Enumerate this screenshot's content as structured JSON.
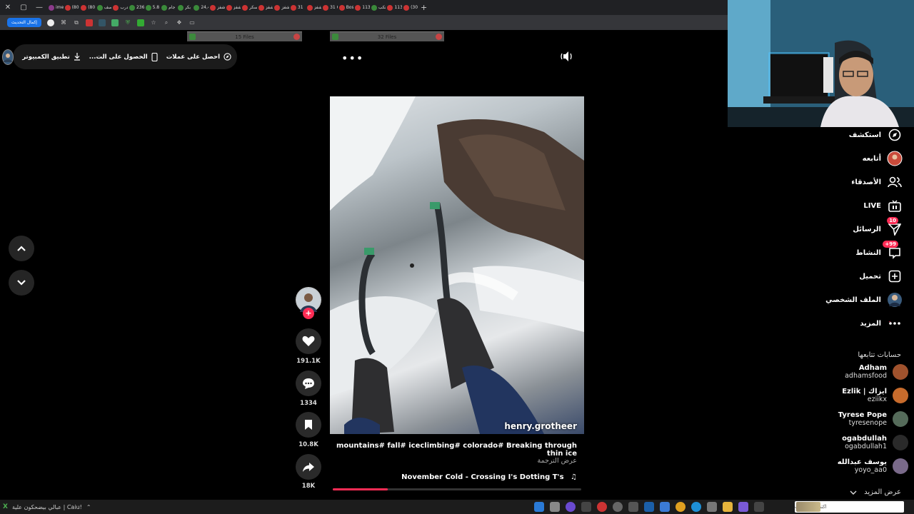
{
  "colors": {
    "accent": "#fe2c55",
    "background": "#000000",
    "surface": "#252525"
  },
  "browser": {
    "tabs": [
      "ime",
      "(80",
      "(80",
      "صف",
      "درب",
      "236",
      "5.8",
      "جام",
      "بكر",
      "24,4",
      "شفز",
      "شفز",
      "سكر",
      "شفز",
      "شفز",
      "31",
      "شفز",
      "31 C",
      "Bos",
      "113",
      "تكب",
      "113",
      "(30"
    ],
    "finish_update_label": "إكمال التحديث",
    "downloads": [
      {
        "label": "15 Files"
      },
      {
        "label": "32 Files"
      }
    ]
  },
  "top_pill": {
    "coins": "احصل على عملات",
    "get_app": "الحصول على الت...",
    "desktop_app": "تطبيق الكمبيوتر"
  },
  "video": {
    "creator_watermark": "henry.grotheer",
    "caption": "mountains# fall# iceclimbing# colorado# Breaking through thin ice",
    "translate": "عرض الترجمة",
    "music": "November Cold - Crossing I's Dotting T's",
    "music_icon": "music-note-icon",
    "progress_fraction": 0.22
  },
  "actions": {
    "likes": "191.1K",
    "comments": "1334",
    "saves": "10.8K",
    "shares": "18K"
  },
  "sidebar": {
    "nav": [
      {
        "label": "استكشف",
        "icon": "compass-icon"
      },
      {
        "label": "أتابعه",
        "icon": "following-avatar-icon"
      },
      {
        "label": "الأصدقاء",
        "icon": "friends-icon"
      },
      {
        "label": "LIVE",
        "icon": "live-tv-icon"
      },
      {
        "label": "الرسائل",
        "icon": "send-icon",
        "badge": "10"
      },
      {
        "label": "النشاط",
        "icon": "activity-icon",
        "badge": "99+"
      },
      {
        "label": "تحميل",
        "icon": "upload-plus-icon"
      },
      {
        "label": "الملف الشخصي",
        "icon": "profile-avatar-icon"
      },
      {
        "label": "المزيد",
        "icon": "more-dots-icon"
      }
    ],
    "following_title": "حسابات تتابعها",
    "following": [
      {
        "name": "Adham",
        "handle": "adhamsfood",
        "color": "#a0522d"
      },
      {
        "name": "Ezlik | ايزاك",
        "handle": "eziikx",
        "color": "#c76b2c"
      },
      {
        "name": "Tyrese Pope",
        "handle": "tyresenope",
        "color": "#556b5a"
      },
      {
        "name": "ogabdullah",
        "handle": "ogabdullah1",
        "color": "#2a2a2a"
      },
      {
        "name": "يوسف عبدالله",
        "handle": "yoyo_aa0",
        "color": "#7a6a8a"
      }
    ],
    "see_more": "عرض المزيد"
  },
  "taskbar": {
    "ticker": "عبالي بيضحكون علية | Caiu!",
    "search_placeholder": "اكتب هنا للبحث"
  }
}
